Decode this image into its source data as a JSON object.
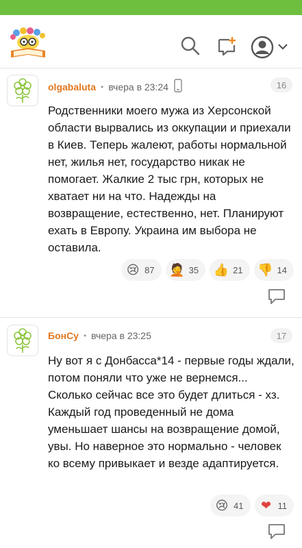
{
  "comments": [
    {
      "author": "olgabaluta",
      "time": "вчера в 23:24",
      "number": "16",
      "text": "Родственники моего мужа из Херсонской области вырвались из оккупации и приехали в Киев. Теперь жалеют, работы нормальной нет, жилья нет, государство никак не помогает. Жалкие 2 тыс грн, которых не хватает ни на что. Надежды на возвращение, естественно, нет. Планируют ехать в Европу. Украина им выбора не оставила.",
      "reactions": [
        {
          "icon": "crying-face-icon",
          "glyph": "😢",
          "count": "87"
        },
        {
          "icon": "facepalm-icon",
          "glyph": "🤦",
          "count": "35"
        },
        {
          "icon": "thumbs-up-icon",
          "glyph": "👍",
          "count": "21"
        },
        {
          "icon": "thumbs-down-icon",
          "glyph": "👎",
          "count": "14"
        }
      ]
    },
    {
      "author": "БонСу",
      "time": "вчера в 23:25",
      "number": "17",
      "text": "Ну вот я с Донбасса*14 - первые годы ждали, потом поняли что уже не вернемся... Сколько сейчас все это будет длиться - хз. Каждый год проведенный не дома уменьшает шансы на возвращение домой, увы. Но наверное это нормально - человек ко всему привыкает и везде адаптируется.",
      "reactions": [
        {
          "icon": "crying-face-icon",
          "glyph": "😢",
          "count": "41"
        },
        {
          "icon": "heart-icon",
          "glyph": "❤",
          "count": "11"
        }
      ]
    }
  ],
  "colors": {
    "status_bar": "#6fbf3e",
    "author": "#e0771f",
    "brand_green": "#8cc63f"
  }
}
